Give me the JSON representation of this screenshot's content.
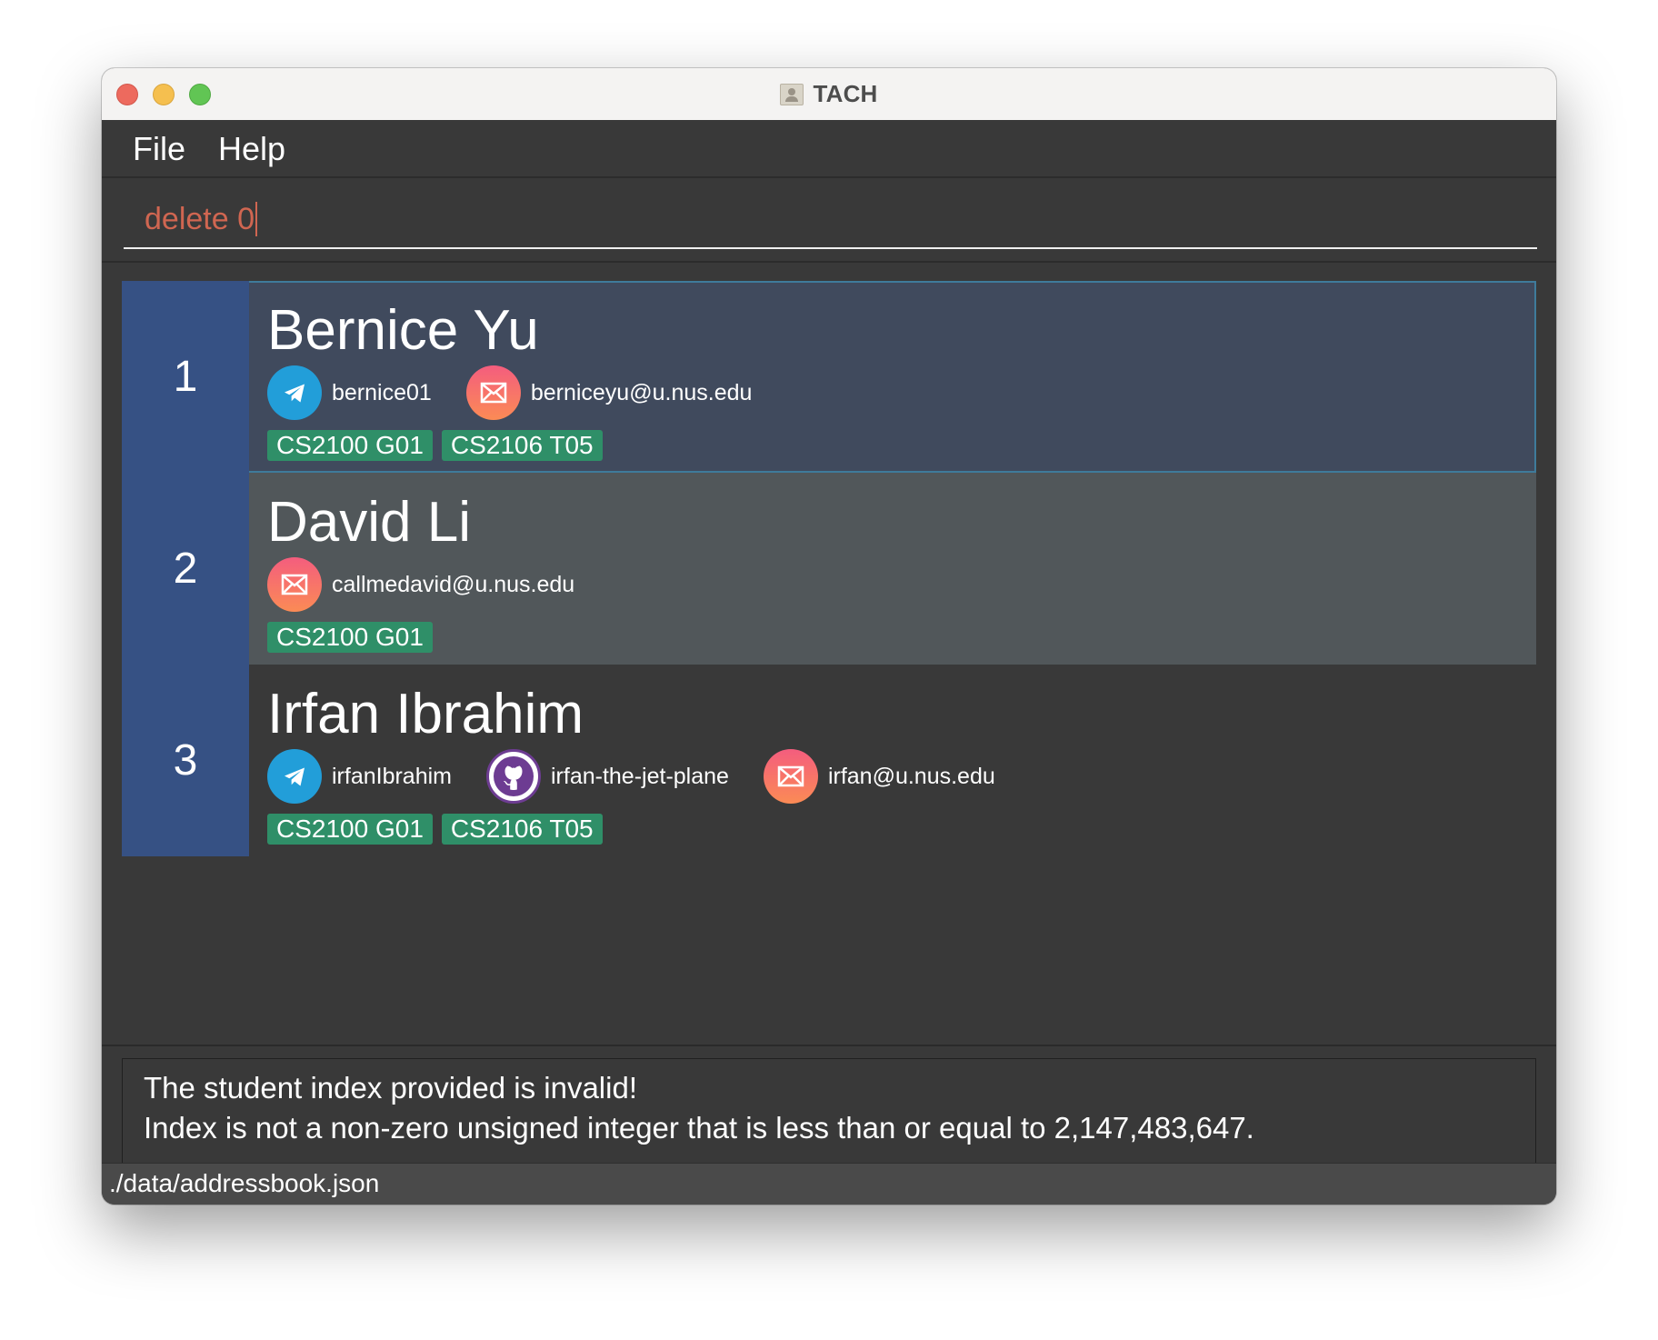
{
  "window": {
    "title": "TACH"
  },
  "menu": {
    "items": [
      {
        "label": "File"
      },
      {
        "label": "Help"
      }
    ]
  },
  "command": {
    "value": "delete 0"
  },
  "students": [
    {
      "index": "1",
      "name": "Bernice Yu",
      "contacts": [
        {
          "type": "telegram",
          "icon": "telegram-icon",
          "value": "bernice01"
        },
        {
          "type": "email",
          "icon": "mail-icon",
          "value": "berniceyu@u.nus.edu"
        }
      ],
      "tags": [
        "CS2100 G01",
        "CS2106 T05"
      ],
      "selected": true
    },
    {
      "index": "2",
      "name": "David Li",
      "contacts": [
        {
          "type": "email",
          "icon": "mail-icon",
          "value": "callmedavid@u.nus.edu"
        }
      ],
      "tags": [
        "CS2100 G01"
      ],
      "selected": false
    },
    {
      "index": "3",
      "name": "Irfan Ibrahim",
      "contacts": [
        {
          "type": "telegram",
          "icon": "telegram-icon",
          "value": "irfanIbrahim"
        },
        {
          "type": "github",
          "icon": "github-icon",
          "value": "irfan-the-jet-plane"
        },
        {
          "type": "email",
          "icon": "mail-icon",
          "value": "irfan@u.nus.edu"
        }
      ],
      "tags": [
        "CS2100 G01",
        "CS2106 T05"
      ],
      "selected": false
    }
  ],
  "result": {
    "lines": [
      "The student index provided is invalid!",
      "Index is not a non-zero unsigned integer that is less than or equal to 2,147,483,647."
    ]
  },
  "status": {
    "path": "./data/addressbook.json"
  },
  "colors": {
    "window_bg": "#393939",
    "command_text": "#d06651",
    "index_bg": "#365184",
    "selected_card_bg": "#404a5d",
    "card_2_bg": "#51575a",
    "tag_bg": "#2f8f68",
    "telegram": "#229ed9",
    "github_border": "#6d3c92"
  }
}
